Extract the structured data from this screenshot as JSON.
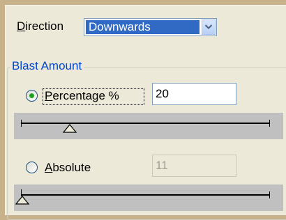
{
  "direction": {
    "label": "Direction",
    "selected": "Downwards"
  },
  "group": {
    "title": "Blast Amount"
  },
  "percentage": {
    "label": "Percentage %",
    "value": "20",
    "selected": true,
    "slider_fraction": 0.19
  },
  "absolute": {
    "label": "Absolute",
    "value": "11",
    "selected": false,
    "enabled": false,
    "slider_fraction": 0.0
  },
  "colors": {
    "frame": "#c7b28b",
    "panel": "#ece9d8",
    "group_title": "#0046d5",
    "selection": "#316ac5"
  }
}
